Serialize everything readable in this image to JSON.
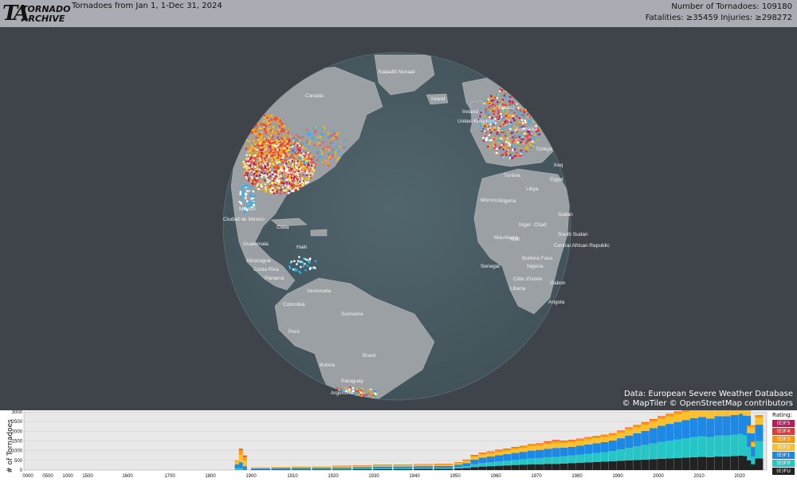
{
  "header": {
    "logo_mark": "TA",
    "logo_line1": "TORNADO",
    "logo_line2": "ARCHIVE",
    "title": "Tornadoes from Jan 1, 1-Dec 31, 2024",
    "count": "Number of Tornadoes: 109180",
    "casualties": "Fatalities: ≥35459    Injuries: ≥298272"
  },
  "map": {
    "labels": [
      "Kalaallit Nunaat",
      "Canada",
      "Island",
      "Ireland",
      "United Kingdom",
      "Poland",
      "Romania",
      "Türkiye",
      "Iraq",
      "Egypt",
      "Libya",
      "Tunisia",
      "Morocco",
      "Algeria",
      "Sudan",
      "Chad",
      "South Sudan",
      "Niger",
      "Mali",
      "Mauritania",
      "Senegal",
      "Burkina Faso",
      "Côte d'Ivoire",
      "Liberia",
      "Nigeria",
      "Central African Republic",
      "Gabon",
      "Angola",
      "United States",
      "Mexico",
      "Ciudad de México",
      "Cuba",
      "Guatemala",
      "Nicaragua",
      "Haiti",
      "Costa Rica",
      "Panamá",
      "Venezuela",
      "Colombia",
      "Suriname",
      "Perú",
      "Brasil",
      "Bolivia",
      "Paraguay",
      "Argentina"
    ],
    "colors": {
      "ocean": "#4d6068",
      "land": "#9aa0a4",
      "background": "#3f444a"
    }
  },
  "credits": {
    "data": "Data: European Severe Weather Database",
    "map": "© MapTiler © OpenStreetMap contributors"
  },
  "chart_data": {
    "type": "bar",
    "ylabel": "# of Tornadoes",
    "xticks": [
      "0000",
      "0500",
      "1000",
      "1500",
      "1600",
      "1700",
      "1800",
      "1900",
      "1910",
      "1920",
      "1930",
      "1940",
      "1950",
      "1960",
      "1970",
      "1980",
      "1990",
      "2000",
      "2010",
      "2020"
    ],
    "yticks": [
      0,
      500,
      1000,
      1500,
      2000,
      2500,
      3000
    ],
    "ylim": [
      0,
      3000
    ],
    "legend_title": "Rating:",
    "series": [
      {
        "name": "(E)F5",
        "color": "#c2185b"
      },
      {
        "name": "(E)F4",
        "color": "#e53935"
      },
      {
        "name": "(E)F3",
        "color": "#ff9800"
      },
      {
        "name": "(E)F2",
        "color": "#fbc02d"
      },
      {
        "name": "(E)F1",
        "color": "#1e88e5"
      },
      {
        "name": "(E)F0",
        "color": "#26c6c6"
      },
      {
        "name": "(E)FU",
        "color": "#222222"
      }
    ],
    "years": [
      1895,
      1896,
      1897,
      1898,
      1899,
      1900,
      1905,
      1910,
      1915,
      1920,
      1925,
      1930,
      1935,
      1940,
      1945,
      1950,
      1952,
      1954,
      1956,
      1958,
      1960,
      1962,
      1964,
      1966,
      1968,
      1970,
      1972,
      1974,
      1976,
      1978,
      1980,
      1982,
      1984,
      1986,
      1988,
      1990,
      1992,
      1994,
      1996,
      1998,
      2000,
      2002,
      2004,
      2006,
      2008,
      2010,
      2012,
      2014,
      2016,
      2018,
      2020,
      2021,
      2022,
      2023,
      2024
    ],
    "stacks": [
      [
        0,
        0,
        0,
        0,
        0,
        0,
        0
      ],
      [
        0,
        0,
        50,
        150,
        200,
        100,
        0
      ],
      [
        0,
        50,
        250,
        400,
        300,
        100,
        0
      ],
      [
        0,
        50,
        200,
        300,
        200,
        0,
        0
      ],
      [
        0,
        0,
        0,
        0,
        0,
        0,
        0
      ],
      [
        0,
        0,
        20,
        40,
        40,
        20,
        20
      ],
      [
        0,
        0,
        20,
        40,
        60,
        20,
        20
      ],
      [
        0,
        0,
        20,
        40,
        60,
        30,
        30
      ],
      [
        0,
        0,
        20,
        40,
        60,
        30,
        30
      ],
      [
        0,
        10,
        30,
        50,
        60,
        40,
        30
      ],
      [
        0,
        10,
        30,
        50,
        70,
        40,
        40
      ],
      [
        0,
        10,
        30,
        60,
        80,
        50,
        50
      ],
      [
        0,
        10,
        30,
        60,
        80,
        50,
        50
      ],
      [
        0,
        10,
        30,
        60,
        80,
        60,
        60
      ],
      [
        0,
        10,
        40,
        60,
        90,
        60,
        60
      ],
      [
        0,
        10,
        40,
        80,
        120,
        80,
        80
      ],
      [
        0,
        20,
        60,
        100,
        160,
        100,
        100
      ],
      [
        0,
        20,
        80,
        140,
        240,
        150,
        150
      ],
      [
        0,
        20,
        80,
        160,
        280,
        180,
        180
      ],
      [
        0,
        20,
        80,
        160,
        300,
        200,
        200
      ],
      [
        0,
        20,
        90,
        180,
        320,
        220,
        220
      ],
      [
        0,
        20,
        90,
        180,
        340,
        240,
        240
      ],
      [
        0,
        20,
        90,
        200,
        360,
        260,
        260
      ],
      [
        0,
        20,
        90,
        200,
        380,
        280,
        280
      ],
      [
        0,
        20,
        100,
        220,
        400,
        300,
        300
      ],
      [
        0,
        20,
        100,
        220,
        420,
        320,
        300
      ],
      [
        0,
        30,
        110,
        240,
        440,
        340,
        320
      ],
      [
        0,
        30,
        120,
        260,
        460,
        360,
        320
      ],
      [
        0,
        20,
        100,
        240,
        440,
        380,
        340
      ],
      [
        0,
        20,
        100,
        240,
        440,
        400,
        360
      ],
      [
        0,
        20,
        100,
        240,
        460,
        420,
        380
      ],
      [
        0,
        20,
        100,
        260,
        480,
        440,
        400
      ],
      [
        0,
        20,
        100,
        260,
        500,
        460,
        420
      ],
      [
        0,
        20,
        100,
        260,
        520,
        480,
        440
      ],
      [
        0,
        20,
        100,
        260,
        540,
        520,
        460
      ],
      [
        0,
        20,
        100,
        280,
        580,
        580,
        480
      ],
      [
        0,
        20,
        100,
        300,
        640,
        640,
        500
      ],
      [
        0,
        20,
        100,
        300,
        680,
        700,
        520
      ],
      [
        0,
        20,
        110,
        320,
        720,
        760,
        540
      ],
      [
        0,
        20,
        110,
        340,
        780,
        820,
        560
      ],
      [
        0,
        20,
        120,
        360,
        820,
        880,
        580
      ],
      [
        0,
        20,
        120,
        380,
        860,
        920,
        600
      ],
      [
        0,
        20,
        130,
        400,
        900,
        960,
        620
      ],
      [
        0,
        20,
        130,
        420,
        940,
        1000,
        640
      ],
      [
        0,
        20,
        140,
        440,
        980,
        1040,
        660
      ],
      [
        0,
        20,
        140,
        460,
        1000,
        1060,
        680
      ],
      [
        0,
        20,
        140,
        440,
        960,
        1040,
        660
      ],
      [
        0,
        20,
        140,
        460,
        1000,
        1080,
        700
      ],
      [
        0,
        20,
        140,
        460,
        1000,
        1080,
        700
      ],
      [
        0,
        20,
        140,
        460,
        1020,
        1100,
        720
      ],
      [
        0,
        20,
        140,
        460,
        1040,
        1120,
        740
      ],
      [
        0,
        20,
        140,
        440,
        1000,
        1080,
        720
      ],
      [
        0,
        10,
        100,
        300,
        700,
        700,
        500
      ],
      [
        0,
        10,
        80,
        200,
        500,
        400,
        300
      ],
      [
        0,
        10,
        120,
        360,
        840,
        900,
        600
      ]
    ]
  }
}
